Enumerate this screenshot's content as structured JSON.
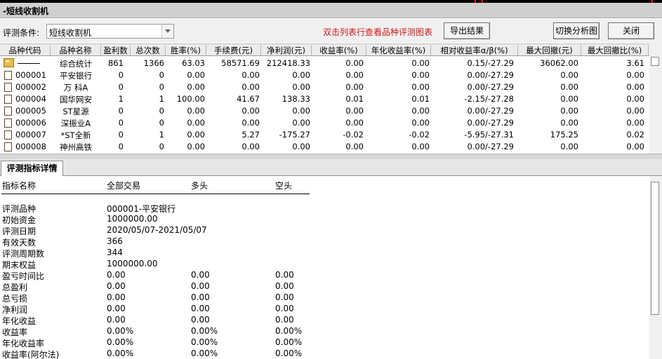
{
  "window": {
    "title": "-短线收割机"
  },
  "toolbar": {
    "criteria_label": "评测条件:",
    "criteria_value": "短线收割机",
    "hint": "双击列表行查看品种评测图表",
    "export_label": "导出结果",
    "switch_chart_label": "切换分析图",
    "close_label": "关闭"
  },
  "grid": {
    "columns": [
      "品种代码",
      "品种名称",
      "盈利数",
      "总次数",
      "胜率(%)",
      "手续费(元)",
      "净利润(元)",
      "收益率(%)",
      "年化收益率(%)",
      "相对收益率α/β(%)",
      "最大回撤(元)",
      "最大回撤比(%)"
    ],
    "rows": [
      [
        "",
        "综合统计",
        "861",
        "1366",
        "63.03",
        "58571.69",
        "212418.33",
        "0.00",
        "0.00",
        "0.15/-27.29",
        "36062.00",
        "3.61"
      ],
      [
        "000001",
        "平安银行",
        "0",
        "0",
        "0.00",
        "0.00",
        "0.00",
        "0.00",
        "0.00",
        "0.00/-27.29",
        "0.00",
        "0.00"
      ],
      [
        "000002",
        "万 科A",
        "0",
        "0",
        "0.00",
        "0.00",
        "0.00",
        "0.00",
        "0.00",
        "0.00/-27.29",
        "0.00",
        "0.00"
      ],
      [
        "000004",
        "国华网安",
        "1",
        "1",
        "100.00",
        "41.67",
        "138.33",
        "0.01",
        "0.01",
        "-2.15/-27.28",
        "0.00",
        "0.00"
      ],
      [
        "000005",
        "ST星源",
        "0",
        "0",
        "0.00",
        "0.00",
        "0.00",
        "0.00",
        "0.00",
        "0.00/-27.29",
        "0.00",
        "0.00"
      ],
      [
        "000006",
        "深振业A",
        "0",
        "0",
        "0.00",
        "0.00",
        "0.00",
        "0.00",
        "0.00",
        "0.00/-27.29",
        "0.00",
        "0.00"
      ],
      [
        "000007",
        "*ST全新",
        "0",
        "1",
        "0.00",
        "5.27",
        "-175.27",
        "-0.02",
        "-0.02",
        "-5.95/-27.31",
        "175.25",
        "0.02"
      ],
      [
        "000008",
        "神州高铁",
        "0",
        "0",
        "0.00",
        "0.00",
        "0.00",
        "0.00",
        "0.00",
        "0.00/-27.29",
        "0.00",
        "0.00"
      ]
    ]
  },
  "tab": {
    "label": "评测指标详情"
  },
  "detail": {
    "headers": [
      "指标名称",
      "全部交易",
      "多头",
      "空头"
    ],
    "rows": [
      [
        "评测品种",
        "000001-平安银行",
        "",
        ""
      ],
      [
        "初始资金",
        "1000000.00",
        "",
        ""
      ],
      [
        "评测日期",
        "2020/05/07-2021/05/07",
        "",
        ""
      ],
      [
        "有效天数",
        "366",
        "",
        ""
      ],
      [
        "评测周期数",
        "344",
        "",
        ""
      ],
      [
        "期末权益",
        "1000000.00",
        "",
        ""
      ],
      [
        "盈亏时间比",
        "0.00",
        "0.00",
        "0.00"
      ],
      [
        "总盈利",
        "0.00",
        "0.00",
        "0.00"
      ],
      [
        "总亏损",
        "0.00",
        "0.00",
        "0.00"
      ],
      [
        "净利润",
        "0.00",
        "0.00",
        "0.00"
      ],
      [
        "年化收益",
        "0.00",
        "0.00",
        "0.00"
      ],
      [
        "收益率",
        "0.00%",
        "0.00%",
        "0.00%"
      ],
      [
        "年化收益率",
        "0.00%",
        "0.00%",
        "0.00%"
      ],
      [
        "收益率(阿尔法)",
        "0.00%",
        "0.00%",
        "0.00%"
      ]
    ]
  }
}
